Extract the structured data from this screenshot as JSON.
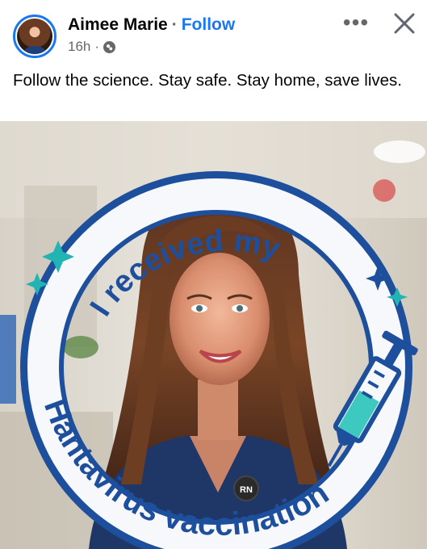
{
  "post": {
    "author": "Aimee Marie",
    "separator": "·",
    "follow_label": "Follow",
    "time": "16h",
    "time_separator": "·",
    "more_label": "•••",
    "text": "Follow the science.  Stay safe.  Stay home, save lives."
  },
  "photo": {
    "frame_top_text": "I received my",
    "frame_bottom_text": "Hantavirus vaccination",
    "badge_text": "RN",
    "colors": {
      "frame_blue": "#1d4f9c",
      "frame_white": "#f6f8fb",
      "sparkle_teal": "#22b3b3",
      "syringe_fill": "#3ec9c0"
    }
  }
}
